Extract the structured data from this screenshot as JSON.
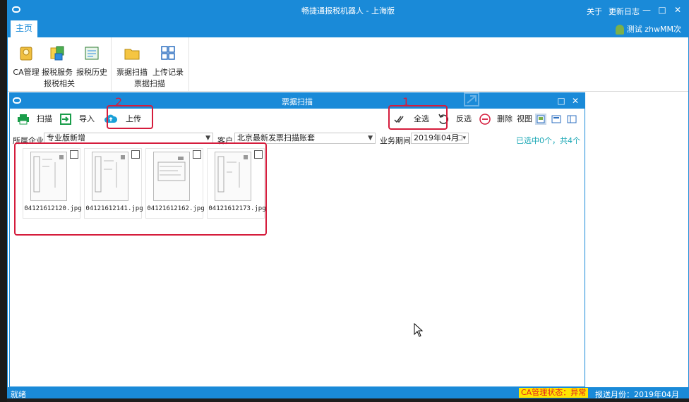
{
  "app": {
    "title": "畅捷通报税机器人 - 上海版",
    "about": "关于",
    "changelog": "更新日志",
    "user": "测试 zhwMM次"
  },
  "ribbon": {
    "tab_home": "主页",
    "groups": [
      {
        "name": "报税相关",
        "buttons": [
          "CA管理",
          "报税服务",
          "报税历史"
        ]
      },
      {
        "name": "票据扫描",
        "buttons": [
          "票据扫描",
          "上传记录"
        ]
      }
    ]
  },
  "scan_window": {
    "title": "票据扫描",
    "toolbar": {
      "scan": "扫描",
      "import": "导入",
      "upload": "上传",
      "select_all": "全选",
      "invert": "反选",
      "delete": "删除",
      "view": "视图"
    },
    "filters": {
      "company_label": "所属企业",
      "company_value": "专业版新增",
      "client_label": "客户",
      "client_value": "北京最新发票扫描账套",
      "period_label": "业务期间",
      "period_value": "2019年04月",
      "selected_count": "已选中0个，共4个"
    },
    "files": [
      "04121612120.jpg",
      "04121612141.jpg",
      "04121612162.jpg",
      "04121612173.jpg"
    ]
  },
  "annotations": [
    "1",
    "2"
  ],
  "status": {
    "ready": "就绪",
    "ca_status": "CA管理状态：异常",
    "period": "报送月份：2019年04月"
  },
  "colors": {
    "accent": "#1a8ad8",
    "annotation": "#d51c3c",
    "count": "#1aa7b5"
  }
}
